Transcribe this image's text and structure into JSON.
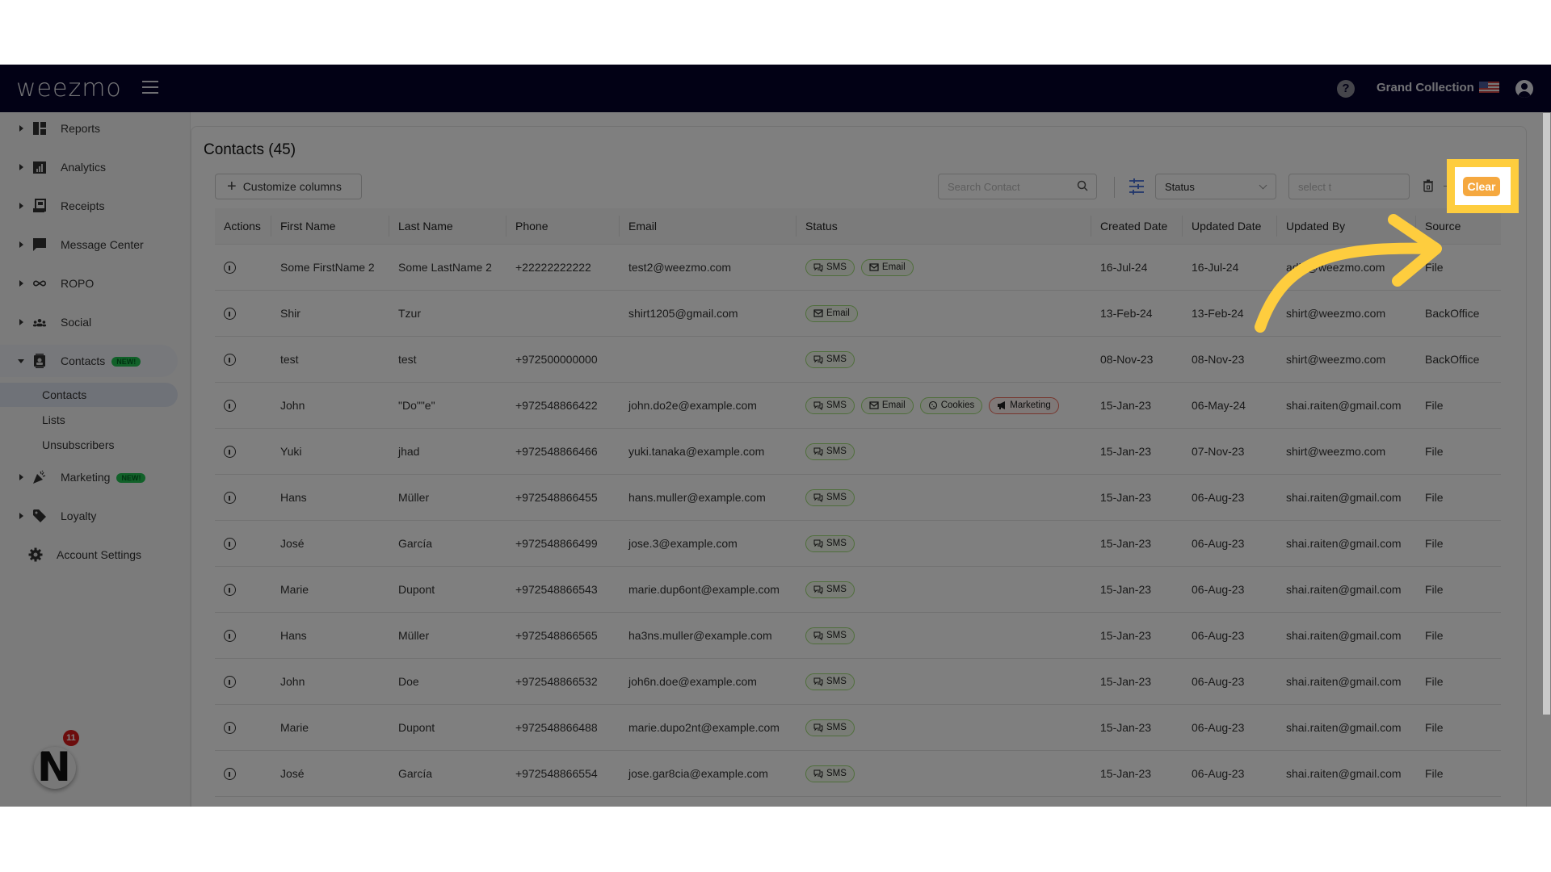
{
  "header": {
    "logo": "weezmo",
    "store_name": "Grand Collection",
    "help_icon": "question-circle-icon",
    "flag_icon": "us-flag-icon",
    "user_icon": "user-circle-icon"
  },
  "sidebar": {
    "items": [
      {
        "label": "Reports",
        "icon": "dashboard-grid-icon"
      },
      {
        "label": "Analytics",
        "icon": "bar-chart-icon"
      },
      {
        "label": "Receipts",
        "icon": "receipt-icon"
      },
      {
        "label": "Message Center",
        "icon": "message-bubble-icon"
      },
      {
        "label": "ROPO",
        "icon": "infinity-icon"
      },
      {
        "label": "Social",
        "icon": "people-group-icon"
      },
      {
        "label": "Contacts",
        "icon": "contact-card-icon",
        "badge": "NEW!",
        "expanded": true
      },
      {
        "label": "Marketing",
        "icon": "party-popper-icon",
        "badge": "NEW!"
      },
      {
        "label": "Loyalty",
        "icon": "tag-icon"
      },
      {
        "label": "Account Settings",
        "icon": "gear-icon"
      }
    ],
    "contacts_subitems": [
      "Contacts",
      "Lists",
      "Unsubscribers"
    ],
    "active_subitem": "Contacts",
    "notification_count": "11",
    "avatar_letter": "N"
  },
  "main": {
    "title": "Contacts (45)",
    "customize_columns_label": "Customize columns",
    "search_placeholder": "Search Contact",
    "status_filter_value": "Status",
    "value_filter_placeholder": "select t",
    "clear_label": "Clear"
  },
  "table": {
    "columns": [
      "Actions",
      "First Name",
      "Last Name",
      "Phone",
      "Email",
      "Status",
      "Created Date",
      "Updated Date",
      "Updated By",
      "Source"
    ],
    "rows": [
      {
        "first": "Some FirstName 2",
        "last": "Some LastName 2",
        "phone": "+22222222222",
        "email": "test2@weezmo.com",
        "status": [
          "SMS",
          "Email"
        ],
        "created": "16-Jul-24",
        "updated": "16-Jul-24",
        "updated_by": "adik@weezmo.com",
        "source": "File"
      },
      {
        "first": "Shir",
        "last": "Tzur",
        "phone": "",
        "email": "shirt1205@gmail.com",
        "status": [
          "Email"
        ],
        "created": "13-Feb-24",
        "updated": "13-Feb-24",
        "updated_by": "shirt@weezmo.com",
        "source": "BackOffice"
      },
      {
        "first": "test",
        "last": "test",
        "phone": "+972500000000",
        "email": "",
        "status": [
          "SMS"
        ],
        "created": "08-Nov-23",
        "updated": "08-Nov-23",
        "updated_by": "shirt@weezmo.com",
        "source": "BackOffice"
      },
      {
        "first": "John",
        "last": "\"Do\"\"e\"",
        "phone": "+972548866422",
        "email": "john.do2e@example.com",
        "status": [
          "SMS",
          "Email",
          "Cookies",
          "Marketing"
        ],
        "created": "15-Jan-23",
        "updated": "06-May-24",
        "updated_by": "shai.raiten@gmail.com",
        "source": "File"
      },
      {
        "first": "Yuki",
        "last": "jhad",
        "phone": "+972548866466",
        "email": "yuki.tanaka@example.com",
        "status": [
          "SMS"
        ],
        "created": "15-Jan-23",
        "updated": "07-Nov-23",
        "updated_by": "shirt@weezmo.com",
        "source": "File"
      },
      {
        "first": "Hans",
        "last": "Müller",
        "phone": "+972548866455",
        "email": "hans.muller@example.com",
        "status": [
          "SMS"
        ],
        "created": "15-Jan-23",
        "updated": "06-Aug-23",
        "updated_by": "shai.raiten@gmail.com",
        "source": "File"
      },
      {
        "first": "José",
        "last": "García",
        "phone": "+972548866499",
        "email": "jose.3@example.com",
        "status": [
          "SMS"
        ],
        "created": "15-Jan-23",
        "updated": "06-Aug-23",
        "updated_by": "shai.raiten@gmail.com",
        "source": "File"
      },
      {
        "first": "Marie",
        "last": "Dupont",
        "phone": "+972548866543",
        "email": "marie.dup6ont@example.com",
        "status": [
          "SMS"
        ],
        "created": "15-Jan-23",
        "updated": "06-Aug-23",
        "updated_by": "shai.raiten@gmail.com",
        "source": "File"
      },
      {
        "first": "Hans",
        "last": "Müller",
        "phone": "+972548866565",
        "email": "ha3ns.muller@example.com",
        "status": [
          "SMS"
        ],
        "created": "15-Jan-23",
        "updated": "06-Aug-23",
        "updated_by": "shai.raiten@gmail.com",
        "source": "File"
      },
      {
        "first": "John",
        "last": "Doe",
        "phone": "+972548866532",
        "email": "joh6n.doe@example.com",
        "status": [
          "SMS"
        ],
        "created": "15-Jan-23",
        "updated": "06-Aug-23",
        "updated_by": "shai.raiten@gmail.com",
        "source": "File"
      },
      {
        "first": "Marie",
        "last": "Dupont",
        "phone": "+972548866488",
        "email": "marie.dupo2nt@example.com",
        "status": [
          "SMS"
        ],
        "created": "15-Jan-23",
        "updated": "06-Aug-23",
        "updated_by": "shai.raiten@gmail.com",
        "source": "File"
      },
      {
        "first": "José",
        "last": "García",
        "phone": "+972548866554",
        "email": "jose.gar8cia@example.com",
        "status": [
          "SMS"
        ],
        "created": "15-Jan-23",
        "updated": "06-Aug-23",
        "updated_by": "shai.raiten@gmail.com",
        "source": "File"
      }
    ]
  },
  "colors": {
    "topbar": "#04032a",
    "accent_clear": "#f5a83f",
    "highlight_annotation": "#fecd3e",
    "pill_green_border": "#9fdc76",
    "pill_red_border": "#ef6b5a",
    "new_badge": "#23c253"
  }
}
